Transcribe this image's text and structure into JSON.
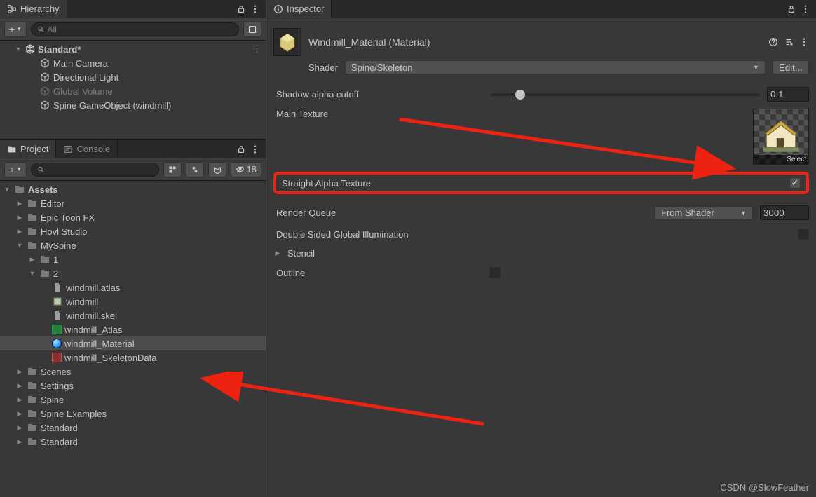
{
  "hierarchy": {
    "tab": "Hierarchy",
    "add_glyph": "+",
    "search_placeholder": "All",
    "scene": "Standard*",
    "items": [
      {
        "label": "Main Camera",
        "dim": false
      },
      {
        "label": "Directional Light",
        "dim": false
      },
      {
        "label": "Global Volume",
        "dim": true
      },
      {
        "label": "Spine GameObject (windmill)",
        "dim": false
      }
    ]
  },
  "project": {
    "tab_project": "Project",
    "tab_console": "Console",
    "add_glyph": "+",
    "search_placeholder": "",
    "hidden_count": "18",
    "root": "Assets",
    "tree": [
      {
        "label": "Editor",
        "depth": 1,
        "type": "folder",
        "expand": "closed"
      },
      {
        "label": "Epic Toon FX",
        "depth": 1,
        "type": "folder",
        "expand": "closed"
      },
      {
        "label": "Hovl Studio",
        "depth": 1,
        "type": "folder",
        "expand": "closed"
      },
      {
        "label": "MySpine",
        "depth": 1,
        "type": "folder",
        "expand": "open"
      },
      {
        "label": "1",
        "depth": 2,
        "type": "folder",
        "expand": "closed"
      },
      {
        "label": "2",
        "depth": 2,
        "type": "folder",
        "expand": "open"
      },
      {
        "label": "windmill.atlas",
        "depth": 3,
        "type": "file"
      },
      {
        "label": "windmill",
        "depth": 3,
        "type": "prefab"
      },
      {
        "label": "windmill.skel",
        "depth": 3,
        "type": "file"
      },
      {
        "label": "windmill_Atlas",
        "depth": 3,
        "type": "atlas"
      },
      {
        "label": "windmill_Material",
        "depth": 3,
        "type": "material",
        "selected": true
      },
      {
        "label": "windmill_SkeletonData",
        "depth": 3,
        "type": "skel"
      },
      {
        "label": "Scenes",
        "depth": 1,
        "type": "folder",
        "expand": "closed"
      },
      {
        "label": "Settings",
        "depth": 1,
        "type": "folder",
        "expand": "closed"
      },
      {
        "label": "Spine",
        "depth": 1,
        "type": "folder",
        "expand": "closed"
      },
      {
        "label": "Spine Examples",
        "depth": 1,
        "type": "folder",
        "expand": "closed"
      },
      {
        "label": "Standard",
        "depth": 1,
        "type": "folder",
        "expand": "closed"
      },
      {
        "label": "Standard",
        "depth": 1,
        "type": "folder",
        "expand": "closed"
      }
    ]
  },
  "inspector": {
    "tab": "Inspector",
    "title": "Windmill_Material (Material)",
    "shader_label": "Shader",
    "shader_value": "Spine/Skeleton",
    "edit_btn": "Edit...",
    "shadow_label": "Shadow alpha cutoff",
    "shadow_value": "0.1",
    "main_texture_label": "Main Texture",
    "texture_select": "Select",
    "straight_alpha_label": "Straight Alpha Texture",
    "render_queue_label": "Render Queue",
    "render_queue_mode": "From Shader",
    "render_queue_value": "3000",
    "double_sided_label": "Double Sided Global Illumination",
    "stencil_label": "Stencil",
    "outline_label": "Outline"
  },
  "watermark": "CSDN @SlowFeather"
}
